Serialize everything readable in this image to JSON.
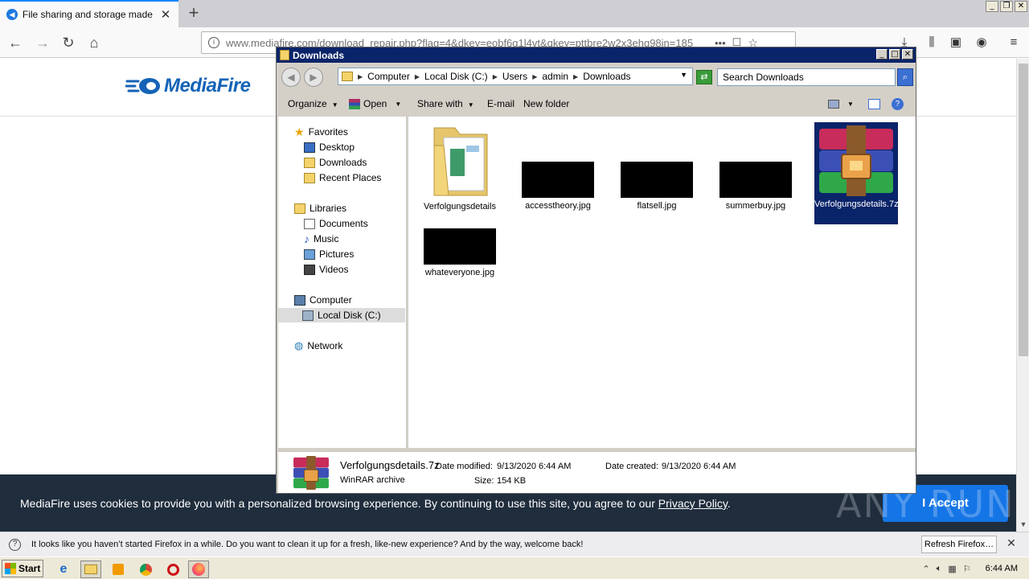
{
  "browser": {
    "tab_title": "File sharing and storage made simple",
    "url": "www.mediafire.com/download_repair.php?flag=4&dkey=eobf6q1l4vt&qkey=pttbre2w2x3ehg98in=185",
    "page_actions": "•••"
  },
  "mediafire": {
    "logo_text": "MediaFire",
    "cookie_text": "MediaFire uses cookies to provide you with a personalized browsing experience. By continuing to use this site, you agree to our ",
    "cookie_link": "Privacy Policy",
    "cookie_period": ".",
    "accept_label": "I Accept"
  },
  "watermark": "ANY RUN",
  "notification": {
    "text": "It looks like you haven’t started Firefox in a while. Do you want to clean it up for a fresh, like-new experience? And by the way, welcome back!",
    "refresh_label": "Refresh Firefox…"
  },
  "explorer": {
    "title": "Downloads",
    "breadcrumb": [
      "Computer",
      "Local Disk (C:)",
      "Users",
      "admin",
      "Downloads"
    ],
    "search_placeholder": "Search Downloads",
    "commands": {
      "organize": "Organize",
      "open": "Open",
      "share_with": "Share with",
      "email": "E-mail",
      "new_folder": "New folder"
    },
    "nav": {
      "favorites": "Favorites",
      "desktop": "Desktop",
      "downloads": "Downloads",
      "recent_places": "Recent Places",
      "libraries": "Libraries",
      "documents": "Documents",
      "music": "Music",
      "pictures": "Pictures",
      "videos": "Videos",
      "computer": "Computer",
      "local_disk": "Local Disk (C:)",
      "network": "Network"
    },
    "files": [
      {
        "name": "Verfolgungsdetails",
        "type": "folder"
      },
      {
        "name": "accesstheory.jpg",
        "type": "image"
      },
      {
        "name": "flatsell.jpg",
        "type": "image"
      },
      {
        "name": "summerbuy.jpg",
        "type": "image"
      },
      {
        "name": "Verfolgungsdetails.7z",
        "type": "archive"
      },
      {
        "name": "whateveryone.jpg",
        "type": "image"
      }
    ],
    "details": {
      "name": "Verfolgungsdetails.7z",
      "type": "WinRAR archive",
      "date_modified_label": "Date modified:",
      "date_modified": "9/13/2020 6:44 AM",
      "date_created_label": "Date created:",
      "date_created": "9/13/2020 6:44 AM",
      "size_label": "Size:",
      "size": "154 KB"
    }
  },
  "taskbar": {
    "start_label": "Start",
    "clock": "6:44 AM"
  },
  "colors": {
    "accent": "#0a84ff",
    "mediafire_blue": "#1463b7",
    "cookie_bg": "#1f2d3d",
    "accept_bg": "#1475e6",
    "explorer_title": "#0a246a"
  }
}
